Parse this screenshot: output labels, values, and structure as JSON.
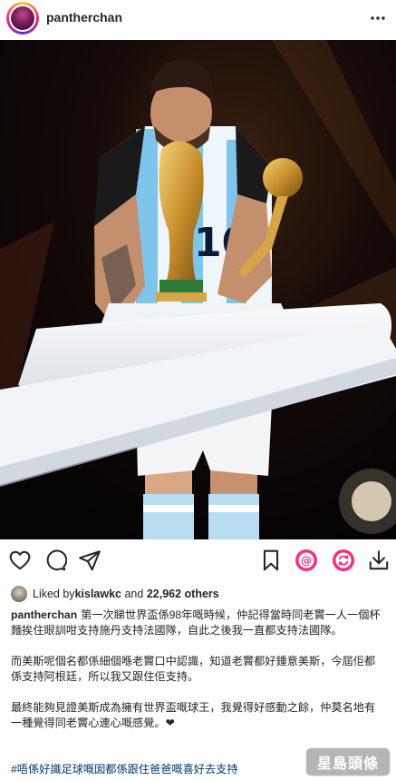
{
  "header": {
    "username": "pantherchan",
    "more_icon": "more-horizontal-icon"
  },
  "actions": {
    "like_icon": "heart-icon",
    "comment_icon": "comment-icon",
    "share_icon": "send-icon",
    "save_icon": "bookmark-icon",
    "extra_icons": [
      "threads-circle-icon",
      "refresh-circle-icon",
      "download-icon"
    ]
  },
  "likes": {
    "prefix": "Liked by ",
    "user": "kislawkc",
    "middle": " and ",
    "count": "22,962 others"
  },
  "caption": {
    "user": "pantherchan",
    "paragraphs": [
      "第一次睇世界盃係98年嘅時候，仲記得當時同老竇一人一個杯麵挨住眼訓咁支持施丹支持法國隊，自此之後我一直都支持法國隊。",
      "而美斯呢個名都係細個喺老竇口中認識，知道老竇都好鍾意美斯，今屆佢都係支持阿根廷，所以我又跟住佢支持。",
      "最終能夠見證美斯成為擁有世界盃嘅球王，我覺得好感動之餘，仲莫名地有一種覺得同老竇心連心嘅感覺。❤"
    ],
    "hashtag": "#唔係好識足球嘅囡都係跟住爸爸嘅喜好去支持"
  },
  "watermark": "星島頭條",
  "colors": {
    "text": "#262626",
    "hashtag": "#00376b",
    "story_ring": [
      "#f9ce34",
      "#ee2a7b",
      "#6228d7"
    ]
  }
}
